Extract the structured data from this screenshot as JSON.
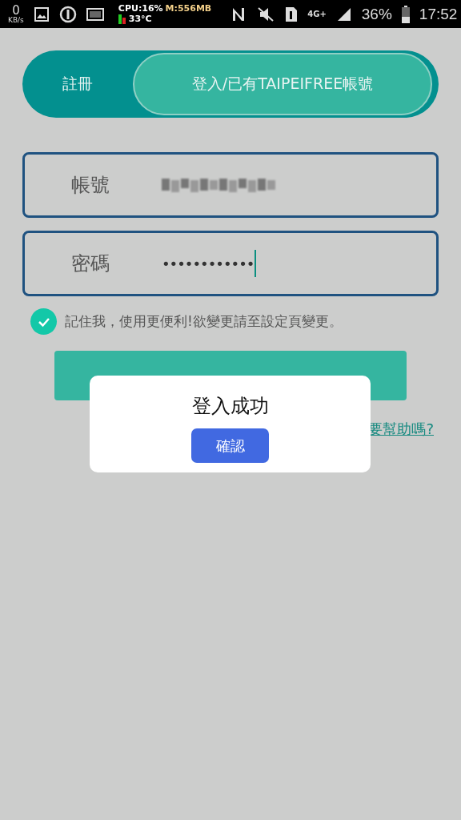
{
  "status_bar": {
    "speed": "0",
    "speed_unit": "KB/s",
    "cpu": "CPU:16%",
    "memory": "M:556MB",
    "temperature": "33°C",
    "network": "4G+",
    "battery": "36%",
    "time": "17:52"
  },
  "tabs": [
    {
      "label": "註冊",
      "selected": false
    },
    {
      "label": "登入/已有TAIPEIFREE帳號",
      "selected": true
    }
  ],
  "fields": [
    {
      "kind": "text",
      "label": "帳號",
      "blurred": true
    },
    {
      "kind": "password",
      "label": "密碼",
      "value": "••••••••••••",
      "focused": true
    }
  ],
  "remember": {
    "label": "記住我，使用更便利!欲變更請至設定頁變更。",
    "checked": true
  },
  "help_link": "要幫助嗎?",
  "dialog": {
    "title": "登入成功",
    "button": "確認"
  }
}
